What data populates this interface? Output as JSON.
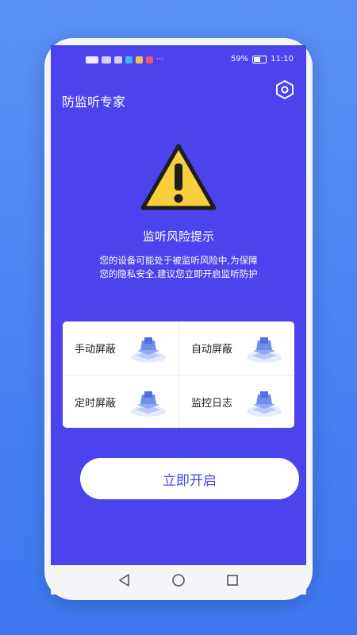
{
  "status_bar": {
    "battery_percent": "59%",
    "time": "11:10",
    "left_icons": [
      "hd-icon",
      "signal-icon",
      "wifi-icon",
      "notification-icons"
    ]
  },
  "header": {
    "title": "防监听专家",
    "settings_icon": "hexagon-settings-icon"
  },
  "warning": {
    "icon": "warning-triangle-icon",
    "title": "监听风险提示",
    "description_line1": "您的设备可能处于被监听风险中,为保障",
    "description_line2": "您的隐私安全,建议您立即开启监听防护"
  },
  "features": [
    {
      "label": "手动屏蔽",
      "icon": "layered-box-icon"
    },
    {
      "label": "自动屏蔽",
      "icon": "layered-box-icon"
    },
    {
      "label": "定时屏蔽",
      "icon": "layered-box-icon"
    },
    {
      "label": "监控日志",
      "icon": "layered-box-icon"
    }
  ],
  "cta_label": "立即开启",
  "nav": {
    "back_icon": "back-triangle-icon",
    "home_icon": "home-circle-icon",
    "recents_icon": "recents-square-icon"
  },
  "colors": {
    "background": "#4b8af3",
    "screen": "#4b43ee",
    "warning_yellow": "#f7d03c",
    "accent": "#4b43ee"
  }
}
